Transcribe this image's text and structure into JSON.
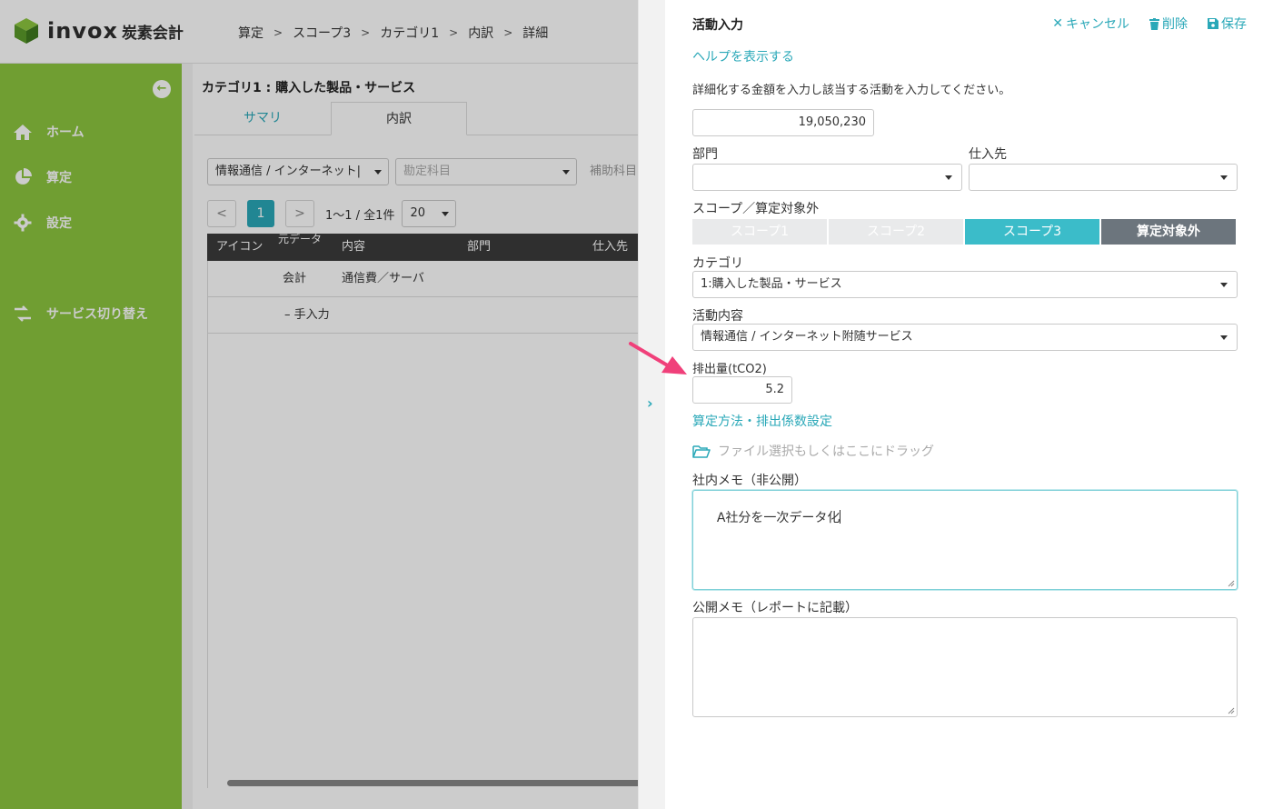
{
  "app": {
    "logo_text": "invox",
    "logo_sub": "炭素会計",
    "breadcrumb": [
      "算定",
      "スコープ3",
      "カテゴリ1",
      "内訳",
      "詳細"
    ]
  },
  "sidebar": {
    "items": [
      {
        "label": "ホーム",
        "icon": "home-icon"
      },
      {
        "label": "算定",
        "icon": "pie-chart-icon"
      },
      {
        "label": "設定",
        "icon": "gear-icon"
      },
      {
        "label": "サービス切り替え",
        "icon": "switch-icon"
      }
    ]
  },
  "main": {
    "title": "カテゴリ1 : 購入した製品・サービス",
    "tabs": [
      {
        "label": "サマリ"
      },
      {
        "label": "内訳"
      }
    ],
    "filters": {
      "activity": "情報通信 / インターネット|",
      "account_placeholder": "勘定科目",
      "sub_account_label": "補助科目"
    },
    "pager": {
      "current": "1",
      "range": "1〜1 / 全1件",
      "per_page": "20"
    },
    "table": {
      "headers": [
        "アイコン",
        "元データ",
        "内容",
        "部門",
        "仕入先"
      ],
      "rows": [
        {
          "source": "会計",
          "content": "通信費／サーバ"
        },
        {
          "source": "– 手入力",
          "content": ""
        }
      ]
    }
  },
  "drawer": {
    "title": "活動入力",
    "actions": {
      "cancel": "キャンセル",
      "delete": "削除",
      "save": "保存"
    },
    "help_link": "ヘルプを表示する",
    "instruction": "詳細化する金額を入力し該当する活動を入力してください。",
    "amount": "19,050,230",
    "department_label": "部門",
    "department_value": "",
    "supplier_label": "仕入先",
    "supplier_value": "",
    "scope_label": "スコープ／算定対象外",
    "scope_options": [
      "スコープ1",
      "スコープ2",
      "スコープ3",
      "算定対象外"
    ],
    "scope_selected": "スコープ3",
    "category_label": "カテゴリ",
    "category_value": "1:購入した製品・サービス",
    "activity_label": "活動内容",
    "activity_value": "情報通信 / インターネット附随サービス",
    "emission_label": "排出量(tCO2)",
    "emission_value": "5.2",
    "method_link": "算定方法・排出係数設定",
    "file_drop": "ファイル選択もしくはここにドラッグ",
    "internal_memo_label": "社内メモ（非公開）",
    "internal_memo_value": "A社分を一次データ化",
    "public_memo_label": "公開メモ（レポートに記載）",
    "public_memo_value": ""
  },
  "colors": {
    "brand_green": "#8cc63f",
    "accent_teal": "#2aa8b8",
    "arrow_pink": "#f0407a"
  }
}
